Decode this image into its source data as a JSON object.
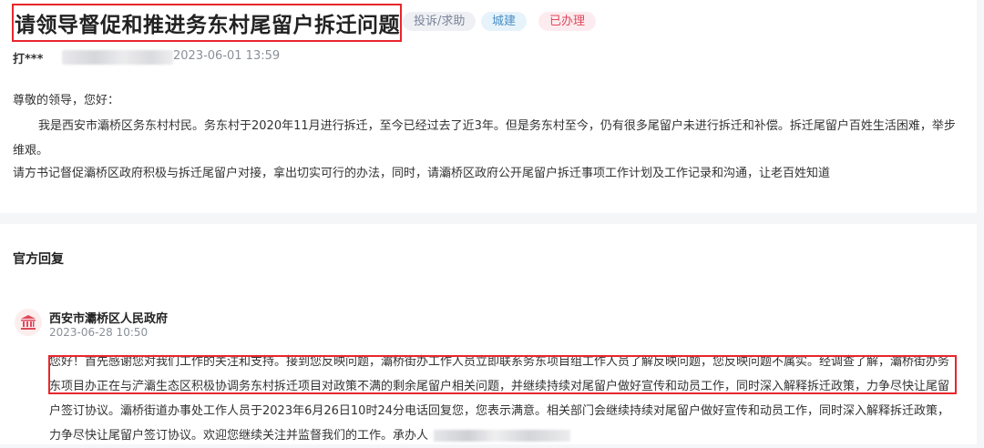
{
  "post": {
    "title": "请领导督促和推进务东村尾留户拆迁问题",
    "tags": {
      "type": "投诉/求助",
      "department": "城建",
      "status": "已办理"
    },
    "author": "打***",
    "datetime": "2023-06-01 13:59",
    "greeting": "尊敬的领导，您好：",
    "body_paragraph": "我是西安市灞桥区务东村村民。务东村于2020年11月进行拆迁，至今已经过去了近3年。但是务东村至今，仍有很多尾留户未进行拆迁和补偿。拆迁尾留户百姓生活困难，举步维艰。",
    "request": "请方书记督促灞桥区政府积极与拆迁尾留户对接，拿出切实可行的办法，同时，请灞桥区政府公开尾留户拆迁事项工作计划及工作记录和沟通，让老百姓知道"
  },
  "official_reply": {
    "section_title": "官方回复",
    "responder": "西安市灞桥区人民政府",
    "datetime": "2023-06-28 10:50",
    "text": "您好！首先感谢您对我们工作的关注和支持。接到您反映问题，灞桥街办工作人员立即联系务东项目组工作人员了解反映问题，您反映问题不属实。经调查了解，灞桥街办务东项目办正在与浐灞生态区积极协调务东村拆迁项目对政策不满的剩余尾留户相关问题，并继续持续对尾留户做好宣传和动员工作，同时深入解释拆迁政策，力争尽快让尾留户签订协议。灞桥街道办事处工作人员于2023年6月26日10时24分电话回复您，您表示满意。相关部门会继续持续对尾留户做好宣传和动员工作，同时深入解释拆迁政策，力争尽快让尾留户签订协议。欢迎您继续关注并监督我们的工作。承办人"
  },
  "colors": {
    "highlight_box": "#e8262d",
    "tag_type_text": "#7a8499",
    "tag_department_text": "#4a8fc4",
    "tag_status_text": "#e0495b"
  },
  "icons": {
    "responder_avatar": "government-building-icon"
  }
}
